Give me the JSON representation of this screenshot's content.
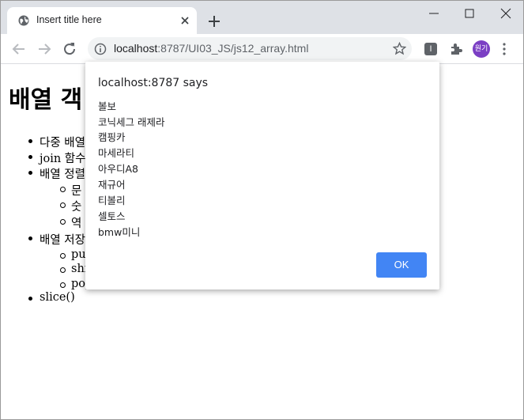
{
  "browser": {
    "tab_title": "Insert title here",
    "url_host": "localhost",
    "url_path": ":8787/UI03_JS/js12_array.html",
    "ext_letter": "I",
    "profile_label": "원기"
  },
  "page": {
    "heading": "배열 객",
    "items": [
      {
        "label": "다중 배열"
      },
      {
        "label": "join 함수"
      },
      {
        "label": "배열 정렬"
      },
      {
        "label": "문"
      },
      {
        "label": "숫"
      },
      {
        "label": "역"
      },
      {
        "label": "배열 저장"
      },
      {
        "label": "pus"
      },
      {
        "label": "shi"
      },
      {
        "label": "pop"
      },
      {
        "label": "slice()"
      }
    ]
  },
  "dialog": {
    "title": "localhost:8787 says",
    "lines": [
      "볼보",
      "코닉세그 래제라",
      "캠핑카",
      "마세라티",
      "아우디A8",
      "재규어",
      "티볼리",
      "셀토스",
      "bmw미니"
    ],
    "ok_label": "OK"
  },
  "colors": {
    "accent": "#4285f4",
    "tabstrip": "#dee1e6",
    "avatar": "#7b3fc4"
  }
}
